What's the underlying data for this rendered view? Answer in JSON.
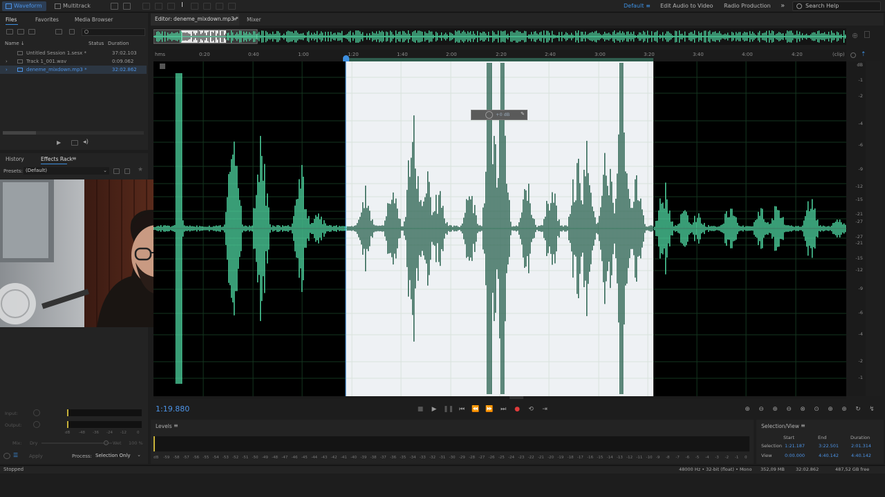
{
  "topbar": {
    "waveform": "Waveform",
    "multitrack": "Multitrack",
    "workspace_default": "Default",
    "edit_audio_to_video": "Edit Audio to Video",
    "radio_production": "Radio Production",
    "search_placeholder": "Search Help"
  },
  "files_panel": {
    "tabs": [
      "Files",
      "Favorites",
      "Media Browser"
    ],
    "columns": {
      "name": "Name ↓",
      "status": "Status",
      "duration": "Duration"
    },
    "files": [
      {
        "name": "Untitled Session 1.sesx *",
        "duration": "37:02.103"
      },
      {
        "name": "Track 1_001.wav",
        "duration": "0:09.062"
      },
      {
        "name": "deneme_mixdown.mp3 *",
        "duration": "32:02.862"
      }
    ]
  },
  "effects_panel": {
    "tabs": [
      "History",
      "Effects Rack"
    ],
    "presets_label": "Presets:",
    "presets_value": "(Default)",
    "input_label": "Input:",
    "output_label": "Output:",
    "mix_label": "Mix:",
    "mix_dry": "Dry",
    "mix_wet": "Wet",
    "apply_label": "Apply",
    "process_label": "Process:",
    "process_value": "Selection Only",
    "meter_ticks": [
      "dB",
      "-48",
      "-36",
      "-24",
      "-12",
      "0"
    ]
  },
  "editor": {
    "tab_label": "Editor: deneme_mixdown.mp3 *",
    "mixer_label": "Mixer",
    "ruler_start": "hms",
    "ruler_end": "(clip)",
    "ticks": [
      "0:20",
      "0:40",
      "1:00",
      "1:20",
      "1:40",
      "2:00",
      "2:20",
      "2:40",
      "3:00",
      "3:20",
      "3:40",
      "4:00",
      "4:20"
    ],
    "db_labels": [
      "dB",
      "-1",
      "-2",
      "-4",
      "-6",
      "-9",
      "-12",
      "-15",
      "-21",
      "-27",
      "-27",
      "-21",
      "-15",
      "-12",
      "-9",
      "-6",
      "-4",
      "-2",
      "-1"
    ],
    "hud_label": "+0 dB"
  },
  "transport": {
    "time": "1:19.880"
  },
  "levels": {
    "title": "Levels",
    "scale": [
      "dB",
      "-59",
      "-58",
      "-57",
      "-56",
      "-55",
      "-54",
      "-53",
      "-52",
      "-51",
      "-50",
      "-49",
      "-48",
      "-47",
      "-46",
      "-45",
      "-44",
      "-43",
      "-42",
      "-41",
      "-40",
      "-39",
      "-38",
      "-37",
      "-36",
      "-35",
      "-34",
      "-33",
      "-32",
      "-31",
      "-30",
      "-29",
      "-28",
      "-27",
      "-26",
      "-25",
      "-24",
      "-23",
      "-22",
      "-21",
      "-20",
      "-19",
      "-18",
      "-17",
      "-16",
      "-15",
      "-14",
      "-13",
      "-12",
      "-11",
      "-10",
      "-9",
      "-8",
      "-7",
      "-6",
      "-5",
      "-4",
      "-3",
      "-2",
      "-1",
      "0"
    ]
  },
  "selection_view": {
    "title": "Selection/View",
    "cols": [
      "Start",
      "End",
      "Duration"
    ],
    "selection_label": "Selection",
    "view_label": "View",
    "selection": [
      "1:21.187",
      "3:22.501",
      "2:01.314"
    ],
    "view": [
      "0:00.000",
      "4:40.142",
      "4:40.142"
    ]
  },
  "status": {
    "state": "Stopped",
    "format": "48000 Hz • 32-bit (float) • Mono",
    "size": "352,09 MB",
    "duration": "32:02.862",
    "free": "487,52 GB free"
  },
  "colors": {
    "accent_blue": "#3d8fe0",
    "wave_green": "#52e0a8",
    "wave_dark": "#1f5a46",
    "record_red": "#e03b3b"
  }
}
